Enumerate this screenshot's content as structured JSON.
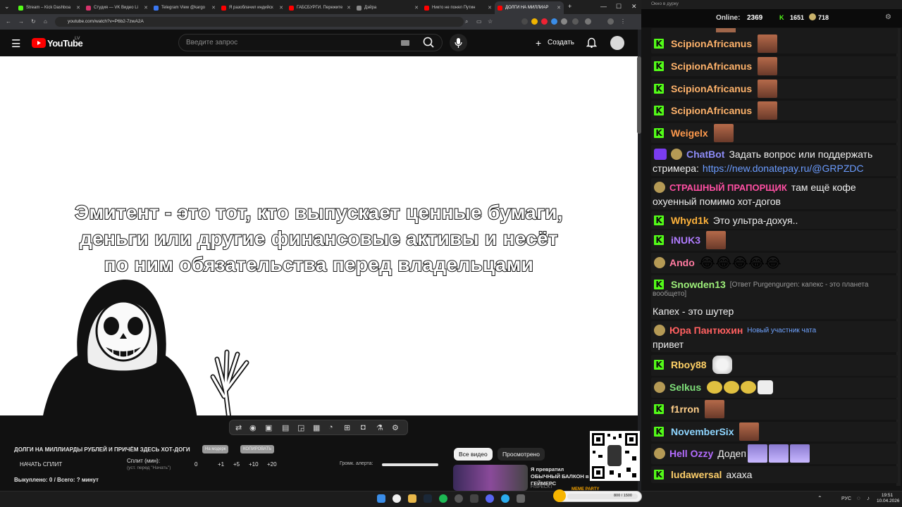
{
  "browser": {
    "tabs": [
      {
        "label": "Stream – Kick Dashboa",
        "color": "#53fc18"
      },
      {
        "label": "Студия — VK Видео Li",
        "color": "#d6336c"
      },
      {
        "label": "Telegram View @kargo",
        "color": "#3a76f0"
      },
      {
        "label": "Я разоблачил индийск",
        "color": "#ff0000"
      },
      {
        "label": "ГАБСБУРГИ. Пережите",
        "color": "#ff0000"
      },
      {
        "label": "Дэйра",
        "color": "#8a8a8a"
      },
      {
        "label": "Никто не понял Путин",
        "color": "#ff0000"
      },
      {
        "label": "ДОЛГИ НА МИЛЛИАР",
        "color": "#ff0000"
      }
    ],
    "url": "youtube.com/watch?v=P6b2-7zwA2A",
    "window": {
      "minimize": "—",
      "maximize": "☐",
      "close": "✕",
      "new_tab": "+"
    }
  },
  "youtube": {
    "logo_text": "YouTube",
    "region": "LV",
    "search_placeholder": "Введите запрос",
    "create_label": "Создать"
  },
  "video": {
    "caption_lines": [
      "Эмитент - это тот, кто выпускает ценные бумаги,",
      "деньги или другие финансовые активы и несёт",
      "по ним обязательства перед владельцами"
    ]
  },
  "panel": {
    "title": "ДОЛГИ НА МИЛЛИАРДЫ РУБЛЕЙ И ПРИЧЁМ ЗДЕСЬ ХОТ-ДОГИ",
    "pill1": "На модерк",
    "pill2": "КОПИРОВАТЬ",
    "start_split": "НАЧАТЬ СПЛИТ",
    "split_label": "Сплит (мин):",
    "split_hint": "(уст. перед \"Начать\")",
    "split_values": [
      "0",
      "+1",
      "+5",
      "+10",
      "+20"
    ],
    "alert_label": "Громк. алерта:",
    "alert_volume": 1.0,
    "footer": "Выкуплено: 0 / Всего: ? минут",
    "chip_all": "Все видео",
    "chip_watched": "Просмотрено",
    "rec_title": "Я превратил ОБЫЧНЫЙ БАЛКОН в ГЕЙМЕРС",
    "rec_channel": "FISPECKT"
  },
  "chat": {
    "window_title": "Окно в дурку",
    "online_label": "Online:",
    "online_count": "2369",
    "stat1": "1651",
    "stat2": "718",
    "messages": [
      {
        "user": "ScipionAfricanus",
        "color": "#ffb36b",
        "text": "",
        "emotes": 1
      },
      {
        "user": "ScipionAfricanus",
        "color": "#ffb36b",
        "text": "",
        "emotes": 1
      },
      {
        "user": "ScipionAfricanus",
        "color": "#ffb36b",
        "text": "",
        "emotes": 1
      },
      {
        "user": "ScipionAfricanus",
        "color": "#ffb36b",
        "text": "",
        "emotes": 1
      },
      {
        "user": "Weigelx",
        "color": "#ff9a4d",
        "text": "",
        "emotes": 1
      },
      {
        "user": "ChatBot",
        "color": "#8d8cf7",
        "text": "Задать вопрос или поддержать",
        "text2": "стримера:",
        "link": "https://new.donatepay.ru/@GRPZDC"
      },
      {
        "user": "СТРАШНЫЙ ПРАПОРЩИК",
        "color": "#ff4fa3",
        "text": "там ещё кофе",
        "text2": "охуенный помимо хот-догов"
      },
      {
        "user": "Whyd1k",
        "color": "#ffb33b",
        "text": "Это ультра-дохуя.."
      },
      {
        "user": "iNUK3",
        "color": "#b07cff",
        "text": "",
        "emotes": 1
      },
      {
        "user": "Ando",
        "color": "#ff7aa0",
        "text": "",
        "laughs": "😂😂😂😂😂"
      },
      {
        "user": "Snowden13",
        "color": "#9ef07a",
        "reply": "[Ответ Purgengurgen: капекс - это планета",
        "reply2": "вообщето]",
        "text2": "Капех - это шутер"
      },
      {
        "user": "Юра Пантюхин",
        "color": "#ff6060",
        "badge_text": "Новый участник чата",
        "text2": "привет"
      },
      {
        "user": "Rboy88",
        "color": "#ffd166",
        "text": ""
      },
      {
        "user": "Selkus",
        "color": "#7fe07a",
        "text": ""
      },
      {
        "user": "f1rron",
        "color": "#ffcf8a",
        "text": ""
      },
      {
        "user": "NovemberSix",
        "color": "#8fd6ff",
        "text": ""
      },
      {
        "user": "Hell Ozzy",
        "color": "#b46cff",
        "text": "Додеп"
      },
      {
        "user": "ludawersal",
        "color": "#ffd06b",
        "text": "ахаха"
      }
    ]
  },
  "overlay": {
    "meme_label": "MEME PARTY",
    "meme_progress": "800 / 1500"
  },
  "taskbar": {
    "lang": "РУС",
    "time": "19:51",
    "date": "10.04.2026"
  }
}
